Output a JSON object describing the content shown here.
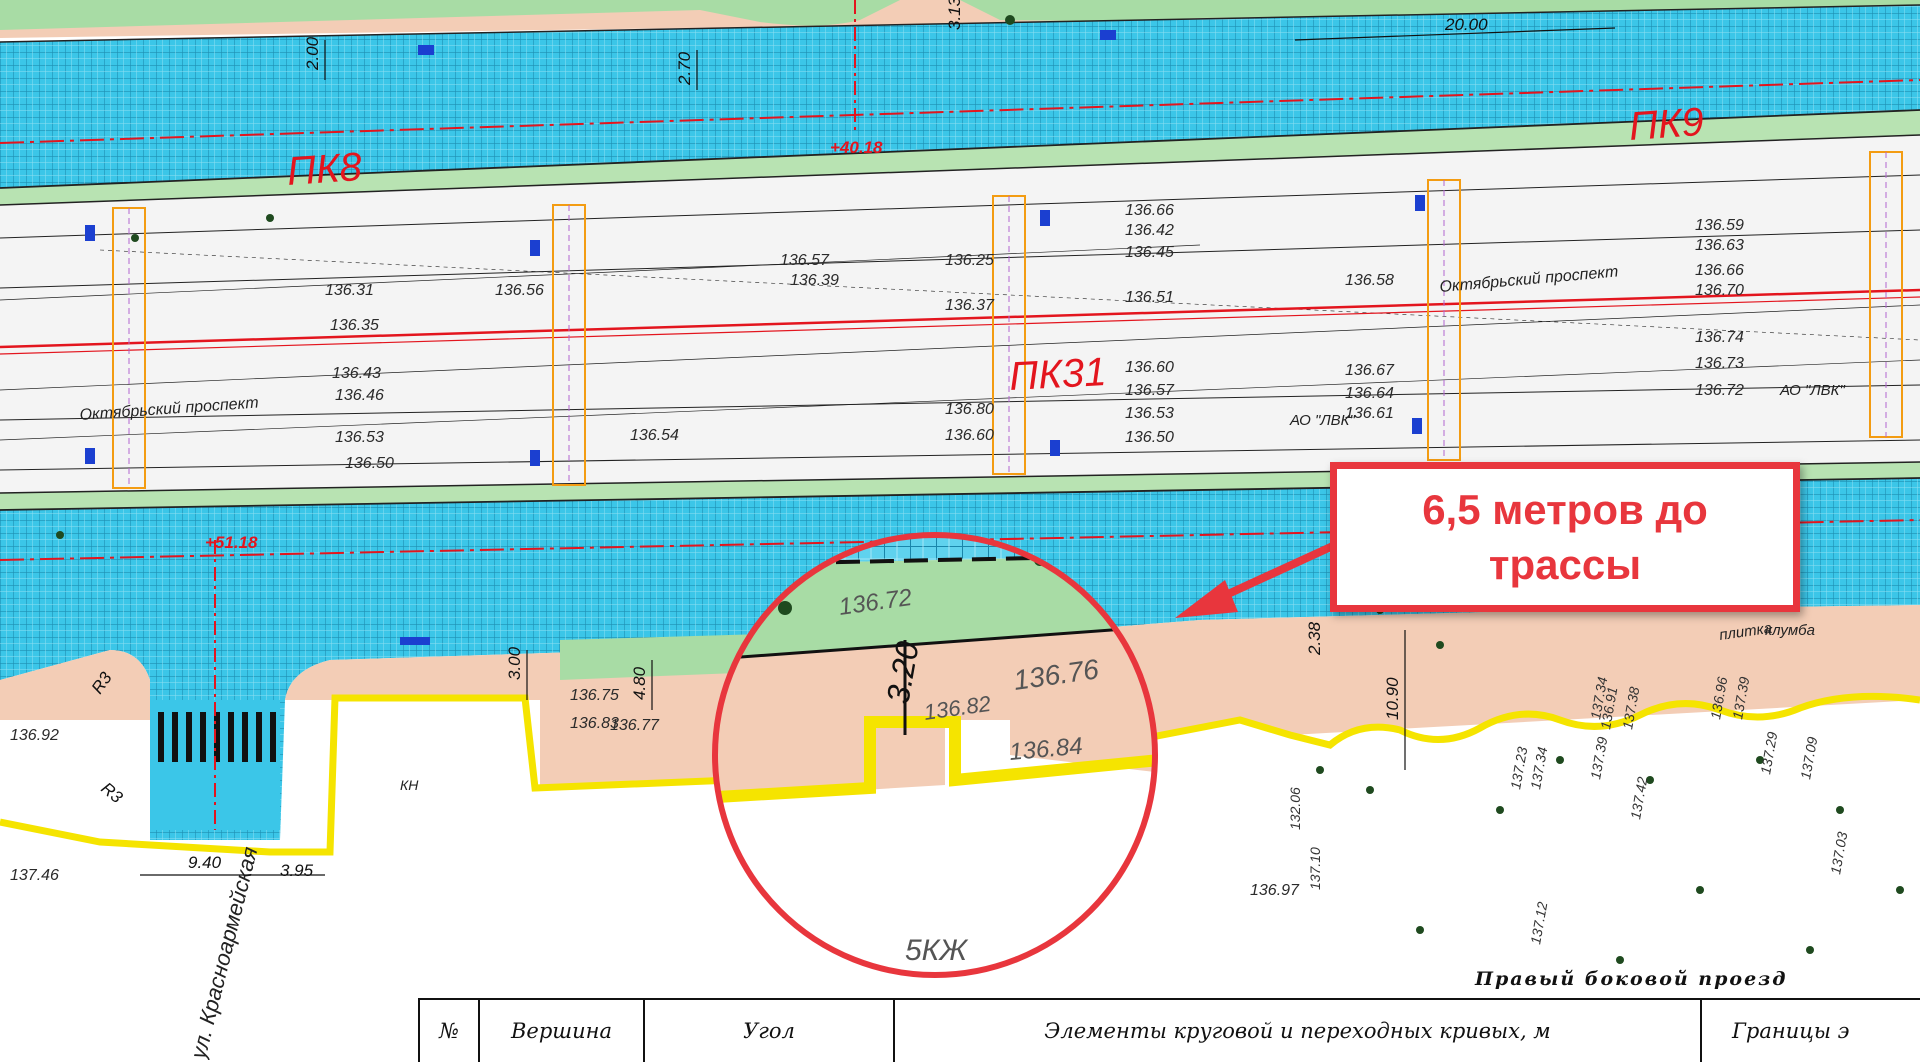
{
  "callout": {
    "text": "6,5 метров до\nтрассы"
  },
  "map_labels": {
    "picket_pk8": "ПК8",
    "picket_pk9": "ПК9",
    "picket_pk31": "ПК31",
    "offset_top": "+40.18",
    "offset_bottom": "+51.18",
    "street_oktyabrsky": "Октябрьский проспект",
    "street_krasnoarm": "ул. Красноармейская",
    "building_5kzh": "5КЖ",
    "building_kn": "КН",
    "tile": "плитка",
    "flowerbed": "клумба",
    "lvk": "АО \"ЛВК\""
  },
  "dimensions": {
    "d1": "20.00",
    "d2": "2.00",
    "d3": "2.70",
    "d4": "3.13",
    "d5": "3.00",
    "d6": "4.80",
    "d7": "2.38",
    "d8": "10.90",
    "d9": "9.40",
    "d10": "3.95",
    "d11": "3.20",
    "d12": "R3",
    "d13": "R3"
  },
  "elevations": {
    "e1": "136.56",
    "e2": "136.31",
    "e3": "136.35",
    "e4": "136.43",
    "e5": "136.46",
    "e6": "136.53",
    "e7": "136.50",
    "e8": "136.57",
    "e9": "136.39",
    "e10": "136.25",
    "e11": "136.37",
    "e12": "136.54",
    "e13": "136.60",
    "e14": "136.66",
    "e15": "136.42",
    "e16": "136.45",
    "e17": "136.51",
    "e18": "136.60",
    "e19": "136.57",
    "e20": "136.53",
    "e21": "136.50",
    "e22": "136.58",
    "e23": "136.67",
    "e24": "136.64",
    "e25": "136.61",
    "e26": "136.59",
    "e27": "136.63",
    "e28": "136.66",
    "e29": "136.70",
    "e30": "136.74",
    "e31": "136.73",
    "e32": "136.72",
    "e33": "136.75",
    "e34": "136.72",
    "e35": "136.76",
    "e36": "136.82",
    "e37": "136.84",
    "e38": "136.77",
    "e39": "136.83",
    "e40": "136.92",
    "e41": "137.46",
    "e42": "137.23",
    "e43": "137.34",
    "e44": "137.39",
    "e45": "137.29",
    "e46": "137.09",
    "e47": "137.42",
    "e48": "137.12",
    "e49": "137.03",
    "e50": "136.97",
    "e51": "137.10",
    "e52": "132.06",
    "e53": "136.80",
    "e54": "137.34",
    "e55": "136.91",
    "e56": "137.38",
    "e57": "136.96",
    "e58": "137.39"
  },
  "table": {
    "title": "Правый боковой проезд",
    "col_no": "№",
    "col_vertex": "Вершина",
    "col_angle": "Угол",
    "col_elements": "Элементы круговой и переходных кривых, м",
    "col_bounds": "Границы э"
  },
  "colors": {
    "road": "#37c3e6",
    "lawn": "#a8dca5",
    "sidewalk": "#f3cdb6",
    "boundary": "#f5e400",
    "accent": "#e8363d"
  }
}
